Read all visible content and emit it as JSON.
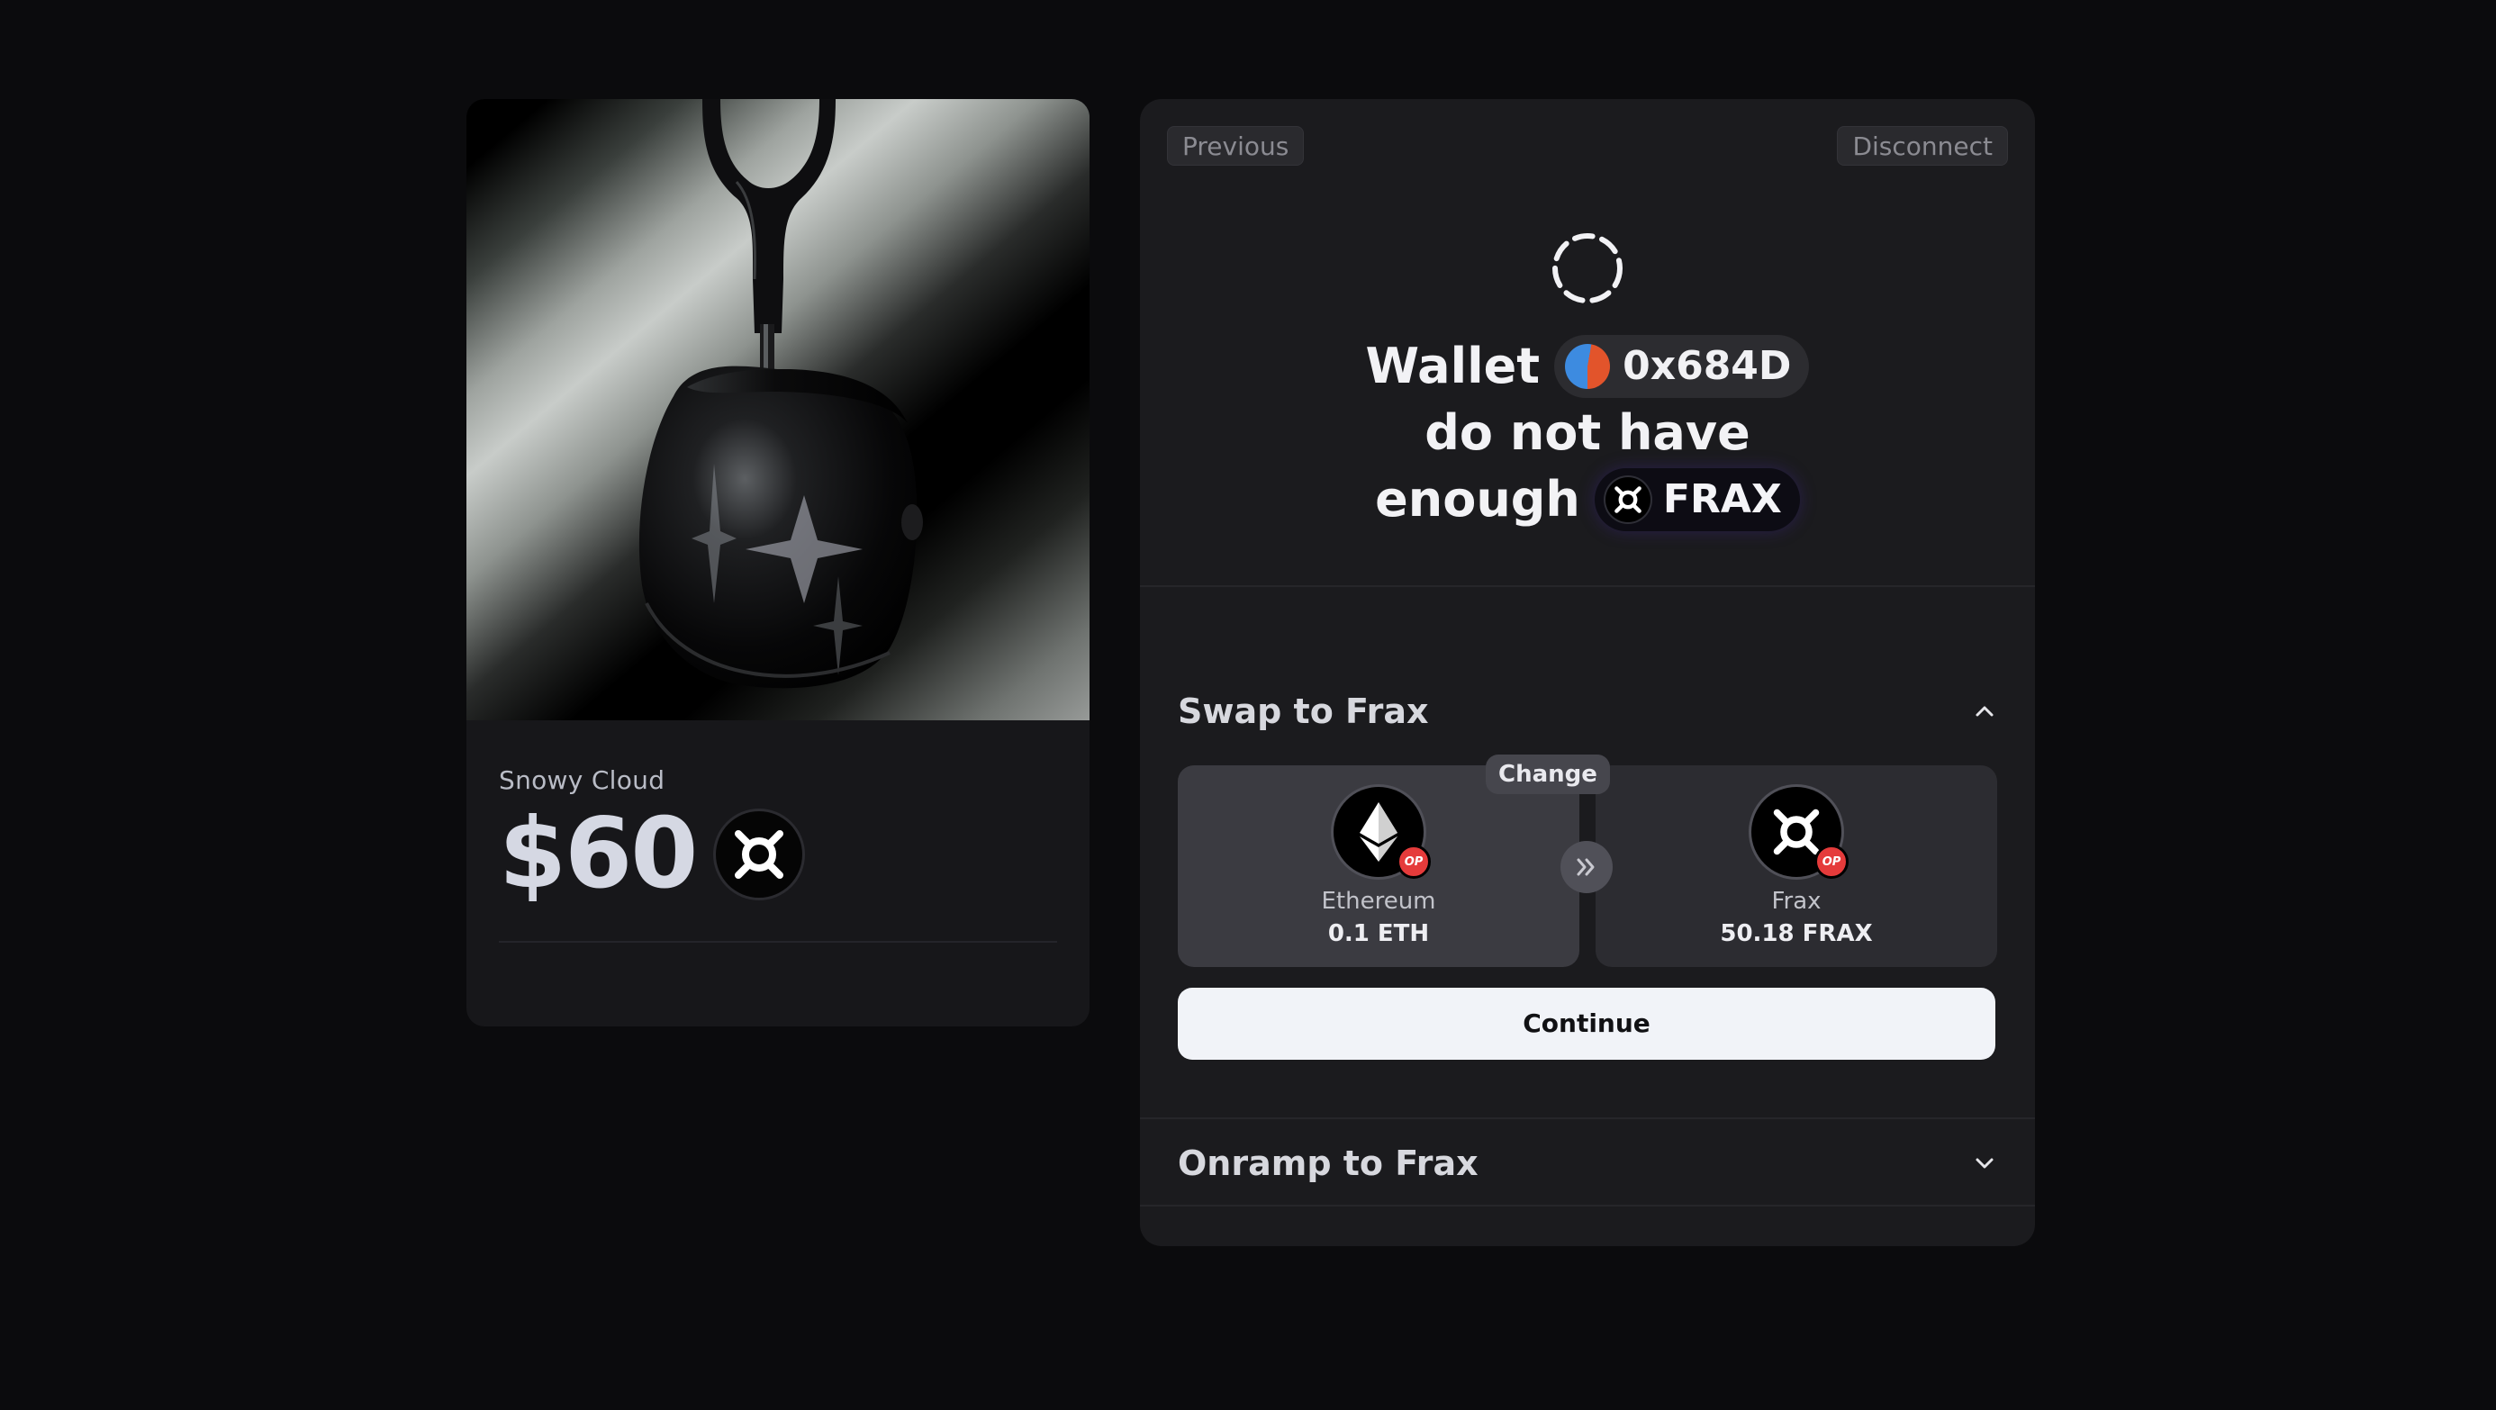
{
  "product": {
    "name": "Snowy Cloud",
    "price": "$60",
    "token_icon": "frax-icon"
  },
  "panel": {
    "previous_label": "Previous",
    "disconnect_label": "Disconnect",
    "status_icon": "loading-spinner-icon",
    "headline": {
      "word_wallet": "Wallet",
      "wallet_address": "0x684D",
      "line2": "do not have",
      "word_enough": "enough",
      "token": "FRAX"
    },
    "swap_section": {
      "title": "Swap to Frax",
      "expanded": true,
      "change_label": "Change",
      "from": {
        "name": "Ethereum",
        "amount": "0.1 ETH",
        "network_badge": "OP"
      },
      "to": {
        "name": "Frax",
        "amount": "50.18 FRAX",
        "network_badge": "OP"
      },
      "continue_label": "Continue"
    },
    "onramp_section": {
      "title": "Onramp to Frax",
      "expanded": false
    }
  },
  "colors": {
    "background": "#0b0b0d",
    "panel": "#1b1b1e",
    "card": "#17171a",
    "op_badge": "#e53b3b",
    "continue_button": "#f1f3f8"
  }
}
